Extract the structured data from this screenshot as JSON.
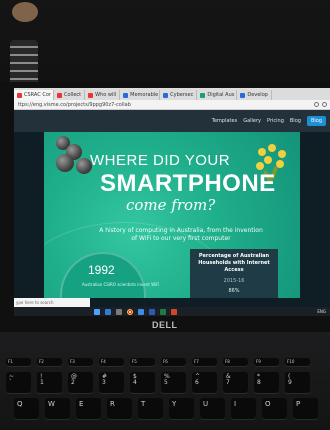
{
  "browser": {
    "tabs": [
      {
        "label": "CSRAC Cor",
        "icon": "red-square-icon"
      },
      {
        "label": "Collect",
        "icon": "red-square-icon"
      },
      {
        "label": "Who will",
        "icon": "red-square-icon"
      },
      {
        "label": "Memorable",
        "icon": "blue-square-icon"
      },
      {
        "label": "Cybersec",
        "icon": "blue-square-icon"
      },
      {
        "label": "Digital Aus",
        "icon": "green-square-icon"
      },
      {
        "label": "Develop",
        "icon": "blue-square-icon"
      }
    ],
    "url": "ttps://eng.visme.co/projects/9ppg90z7-collab"
  },
  "site_nav": {
    "items": [
      "Templates",
      "Gallery",
      "Pricing",
      "Blog"
    ],
    "blog_label": "Blog"
  },
  "infographic": {
    "line1": "WHERE DID YOUR",
    "line2": "SMARTPHONE",
    "line3": "come from?",
    "subtitle": "A history of computing in Australia, from the invention of WiFi to our very first computer",
    "year": "1992",
    "year_caption": "Australian CSIRO scientists invent WiFi",
    "stat_title": "Percentage of Australian Households with Internet Access",
    "stat_year": "2015-16",
    "stat_value": "86%"
  },
  "taskbar": {
    "search_placeholder": "ype here to search",
    "tray_text": "ENG"
  },
  "laptop": {
    "brand": "DELL"
  },
  "keyboard": {
    "fn_row": [
      "F1",
      "F2",
      "F3",
      "F4",
      "F5",
      "F6",
      "F7",
      "F8",
      "F9",
      "F10",
      "F11"
    ],
    "number_row": [
      "~",
      "!",
      "@",
      "#",
      "$",
      "%",
      "^",
      "&",
      "*",
      "(",
      ")"
    ],
    "number_row_lower": [
      "`",
      "1",
      "2",
      "3",
      "4",
      "5",
      "6",
      "7",
      "8",
      "9",
      "0"
    ],
    "letter_row": [
      "Q",
      "W",
      "E",
      "R",
      "T",
      "Y",
      "U",
      "I",
      "O",
      "P"
    ]
  },
  "colors": {
    "infographic_green": "#1fae8a",
    "stat_box": "#1f3b45",
    "blog_button": "#1d8fd6"
  }
}
